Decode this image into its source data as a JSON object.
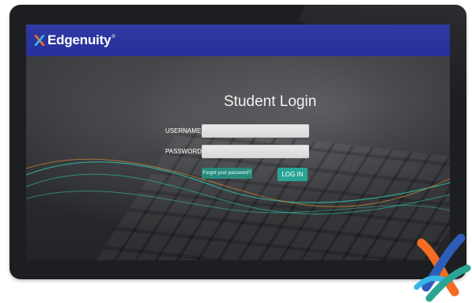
{
  "brand": {
    "name": "Edgenuity",
    "trademark": "®",
    "colors": {
      "header": "#2f3aa3",
      "teal": "#2aa594",
      "orange": "#f36c21",
      "blue": "#2d5db8"
    }
  },
  "login": {
    "title": "Student Login",
    "username_label": "USERNAME",
    "password_label": "PASSWORD",
    "username_value": "",
    "password_value": "",
    "forgot_label": "Forgot your password?",
    "login_button_label": "LOG IN"
  },
  "icons": {
    "header_logo": "edgenuity-x-icon",
    "corner_logo": "edgenuity-x-large-icon"
  }
}
